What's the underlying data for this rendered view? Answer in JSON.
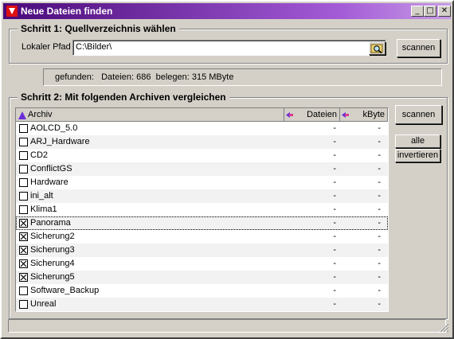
{
  "window": {
    "title": "Neue Dateien finden"
  },
  "step1": {
    "title": "Schritt 1: Quellverzeichnis wählen",
    "path_label": "Lokaler Pfad",
    "path_value": "C:\\Bilder\\",
    "scan_label": "scannen"
  },
  "summary": {
    "text": "gefunden:   Dateien: 686  belegen: 315 MByte"
  },
  "step2": {
    "title": "Schritt 2: Mit folgenden Archiven vergleichen",
    "columns": {
      "archiv": "Archiv",
      "dateien": "Dateien",
      "kbyte": "kByte"
    },
    "scan_label": "scannen",
    "all_label": "alle",
    "invert_label": "invertieren",
    "rows": [
      {
        "name": "AOLCD_5.0",
        "dateien": "-",
        "kbyte": "-",
        "checked": false
      },
      {
        "name": "ARJ_Hardware",
        "dateien": "-",
        "kbyte": "-",
        "checked": false
      },
      {
        "name": "CD2",
        "dateien": "-",
        "kbyte": "-",
        "checked": false
      },
      {
        "name": "ConflictGS",
        "dateien": "-",
        "kbyte": "-",
        "checked": false
      },
      {
        "name": "Hardware",
        "dateien": "-",
        "kbyte": "-",
        "checked": false
      },
      {
        "name": "ini_alt",
        "dateien": "-",
        "kbyte": "-",
        "checked": false
      },
      {
        "name": "Klima1",
        "dateien": "-",
        "kbyte": "-",
        "checked": false
      },
      {
        "name": "Panorama",
        "dateien": "-",
        "kbyte": "-",
        "checked": true
      },
      {
        "name": "Sicherung2",
        "dateien": "-",
        "kbyte": "-",
        "checked": true
      },
      {
        "name": "Sicherung3",
        "dateien": "-",
        "kbyte": "-",
        "checked": true
      },
      {
        "name": "Sicherung4",
        "dateien": "-",
        "kbyte": "-",
        "checked": true
      },
      {
        "name": "Sicherung5",
        "dateien": "-",
        "kbyte": "-",
        "checked": true
      },
      {
        "name": "Software_Backup",
        "dateien": "-",
        "kbyte": "-",
        "checked": false
      },
      {
        "name": "Unreal",
        "dateien": "-",
        "kbyte": "-",
        "checked": false
      }
    ],
    "selected_row": "Panorama"
  },
  "icons": {
    "app": "app-icon",
    "browse": "folder-search-icon",
    "sort": "sort-arrow-icon",
    "resize": "resize-grip-icon"
  },
  "colors": {
    "title_start": "#4a0a7a",
    "title_end": "#c79ae6",
    "sort_arrow": "#6b2bd9"
  }
}
